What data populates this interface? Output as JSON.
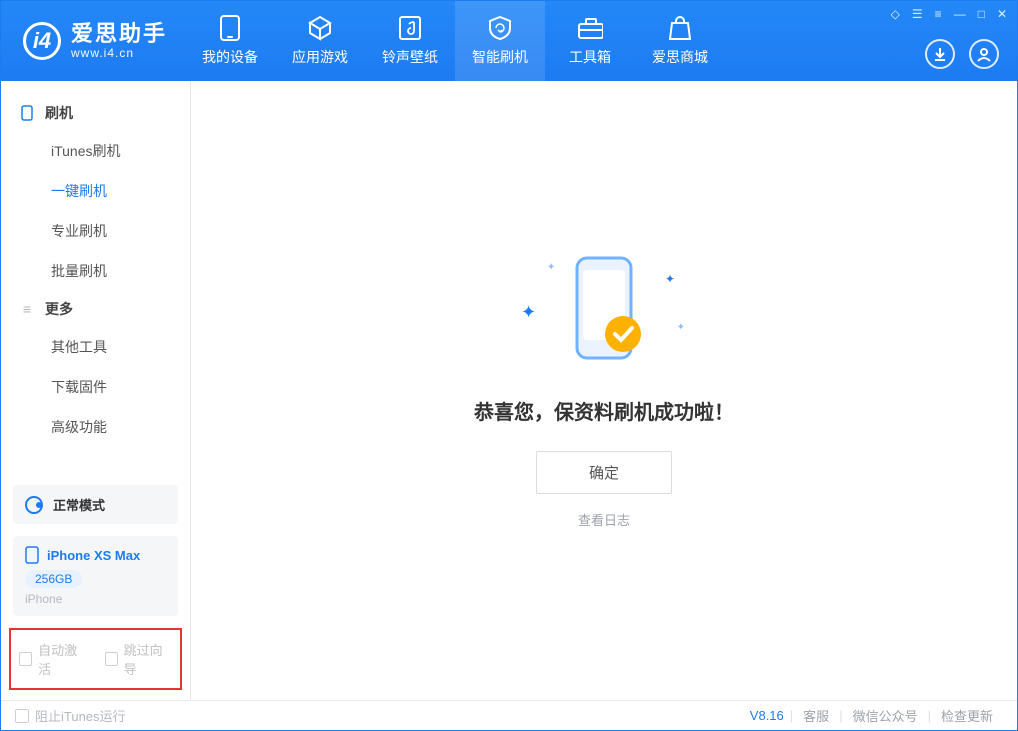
{
  "app": {
    "name_cn": "爱思助手",
    "url": "www.i4.cn"
  },
  "tabs": [
    {
      "label": "我的设备"
    },
    {
      "label": "应用游戏"
    },
    {
      "label": "铃声壁纸"
    },
    {
      "label": "智能刷机"
    },
    {
      "label": "工具箱"
    },
    {
      "label": "爱思商城"
    }
  ],
  "sidebar": {
    "sections": [
      {
        "title": "刷机",
        "items": [
          "iTunes刷机",
          "一键刷机",
          "专业刷机",
          "批量刷机"
        ]
      },
      {
        "title": "更多",
        "items": [
          "其他工具",
          "下载固件",
          "高级功能"
        ]
      }
    ],
    "mode_label": "正常模式",
    "device": {
      "name": "iPhone XS Max",
      "capacity": "256GB",
      "type": "iPhone"
    },
    "opts": {
      "auto_activate": "自动激活",
      "skip_wizard": "跳过向导"
    }
  },
  "main": {
    "success": "恭喜您，保资料刷机成功啦！",
    "ok": "确定",
    "view_log": "查看日志"
  },
  "footer": {
    "block_itunes": "阻止iTunes运行",
    "version": "V8.16",
    "links": [
      "客服",
      "微信公众号",
      "检查更新"
    ]
  }
}
